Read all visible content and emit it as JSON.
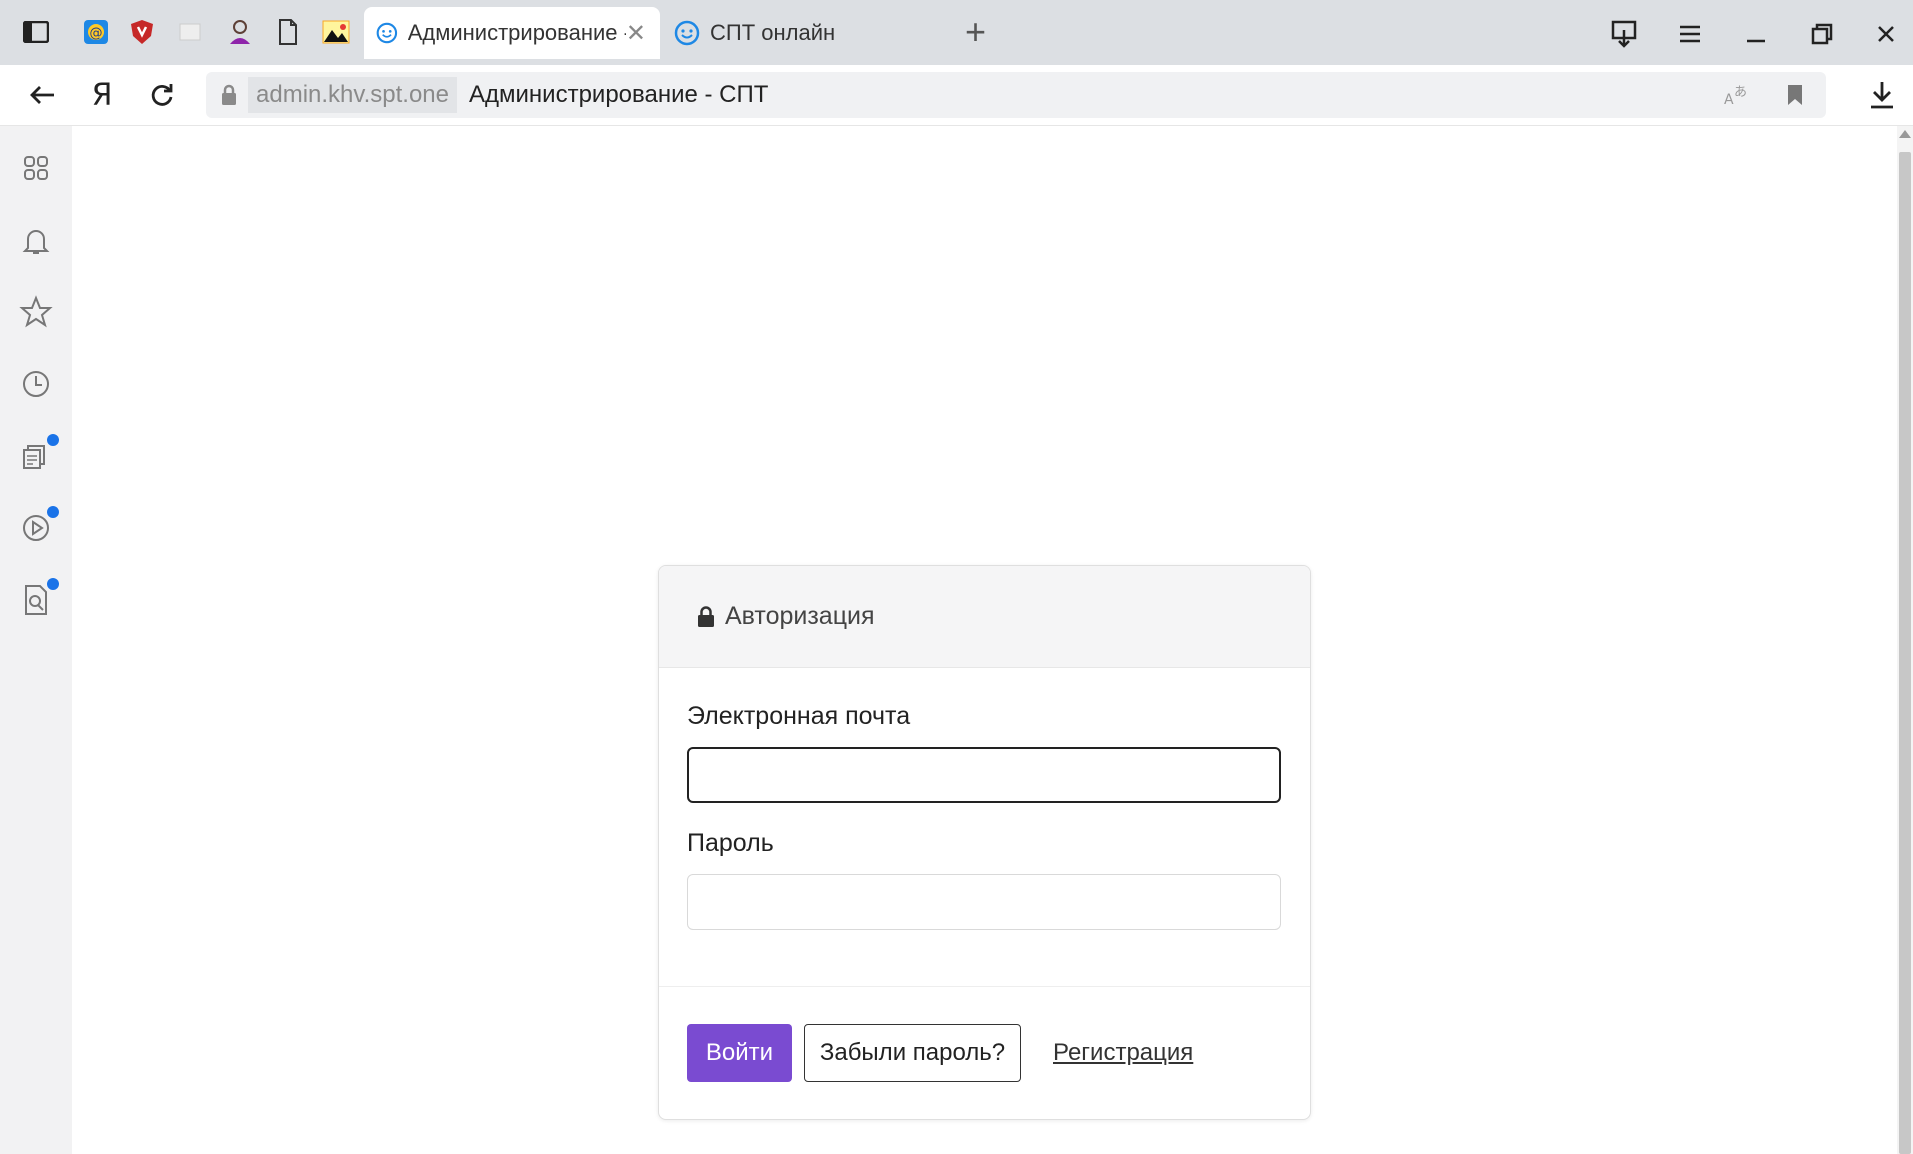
{
  "browser": {
    "tabs": [
      {
        "title": "Администрирование - СП",
        "active": true,
        "icon": "smile-favicon"
      },
      {
        "title": "СПТ онлайн",
        "active": false,
        "icon": "smile-favicon"
      }
    ],
    "address": {
      "domain": "admin.khv.spt.one",
      "page_title": "Администрирование - СПТ"
    }
  },
  "login": {
    "header": "Авторизация",
    "email_label": "Электронная почта",
    "email_value": "",
    "password_label": "Пароль",
    "password_value": "",
    "submit_label": "Войти",
    "forgot_label": "Забыли пароль?",
    "register_label": "Регистрация"
  },
  "colors": {
    "accent": "#7a4bd1",
    "tabbar": "#dcdfe3",
    "notification_dot": "#1a73e8"
  }
}
